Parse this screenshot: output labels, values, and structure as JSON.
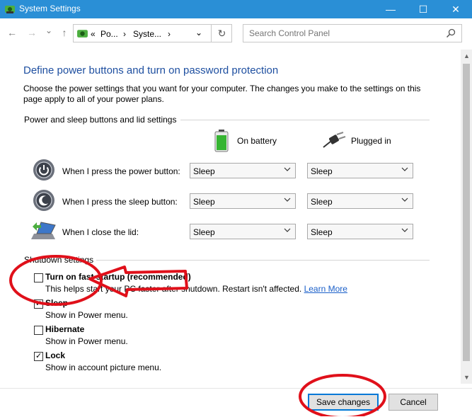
{
  "window": {
    "title": "System Settings",
    "minimize": "—",
    "maximize": "☐",
    "close": "✕"
  },
  "nav": {
    "back": "←",
    "forward": "→",
    "recent": "⌄",
    "up": "↑",
    "refresh": "↻",
    "address_dropdown": "⌄",
    "breadcrumb": [
      "«",
      "Po...",
      "›",
      "Syste...",
      "›"
    ]
  },
  "search": {
    "placeholder": "Search Control Panel"
  },
  "page": {
    "heading": "Define power buttons and turn on password protection",
    "description": "Choose the power settings that you want for your computer. The changes you make to the settings on this page apply to all of your power plans."
  },
  "power_section": {
    "label": "Power and sleep buttons and lid settings",
    "col_battery": "On battery",
    "col_plugged": "Plugged in",
    "rows": [
      {
        "label": "When I press the power button:",
        "battery": "Sleep",
        "plugged": "Sleep",
        "icon": "power-button-icon"
      },
      {
        "label": "When I press the sleep button:",
        "battery": "Sleep",
        "plugged": "Sleep",
        "icon": "sleep-button-icon"
      },
      {
        "label": "When I close the lid:",
        "battery": "Sleep",
        "plugged": "Sleep",
        "icon": "laptop-lid-icon"
      }
    ]
  },
  "shutdown_section": {
    "label": "Shutdown settings",
    "options": [
      {
        "title": "Turn on fast startup (recommended)",
        "desc": "This helps start your PC faster after shutdown. Restart isn't affected.",
        "link": "Learn More",
        "checked": false
      },
      {
        "title": "Sleep",
        "desc": "Show in Power menu.",
        "checked": true
      },
      {
        "title": "Hibernate",
        "desc": "Show in Power menu.",
        "checked": false
      },
      {
        "title": "Lock",
        "desc": "Show in account picture menu.",
        "checked": true
      }
    ]
  },
  "buttons": {
    "save": "Save changes",
    "cancel": "Cancel"
  },
  "colors": {
    "titlebar": "#2a8fd6",
    "heading": "#1e4fa0",
    "annotation": "#e0101a"
  }
}
